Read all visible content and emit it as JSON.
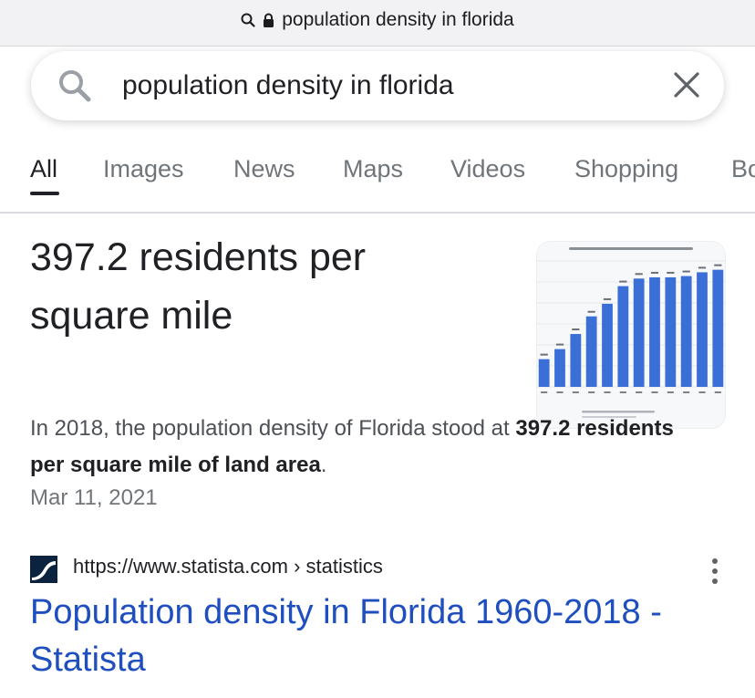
{
  "address_bar": {
    "url_text": "population density in florida"
  },
  "search": {
    "query": "population density in florida"
  },
  "tabs": [
    "All",
    "Images",
    "News",
    "Maps",
    "Videos",
    "Shopping",
    "Bo"
  ],
  "answer": {
    "headline": "397.2 residents per square mile",
    "snippet_before": "In 2018, the population density of Florida stood at ",
    "snippet_bold": "397.2 residents per square mile of land area",
    "snippet_after": ".",
    "date": "Mar 11, 2021"
  },
  "thumbnail_chart": {
    "type": "bar",
    "bar_color": "#3b6fd8",
    "relative_heights": [
      0.22,
      0.3,
      0.42,
      0.56,
      0.66,
      0.8,
      0.86,
      0.87,
      0.87,
      0.88,
      0.91,
      0.93
    ]
  },
  "result": {
    "url": "https://www.statista.com › statistics",
    "title": "Population density in Florida 1960-2018 - Statista"
  },
  "colors": {
    "link": "#1f4fbf",
    "active_tab": "#202124",
    "inactive_tab": "#70757a"
  }
}
